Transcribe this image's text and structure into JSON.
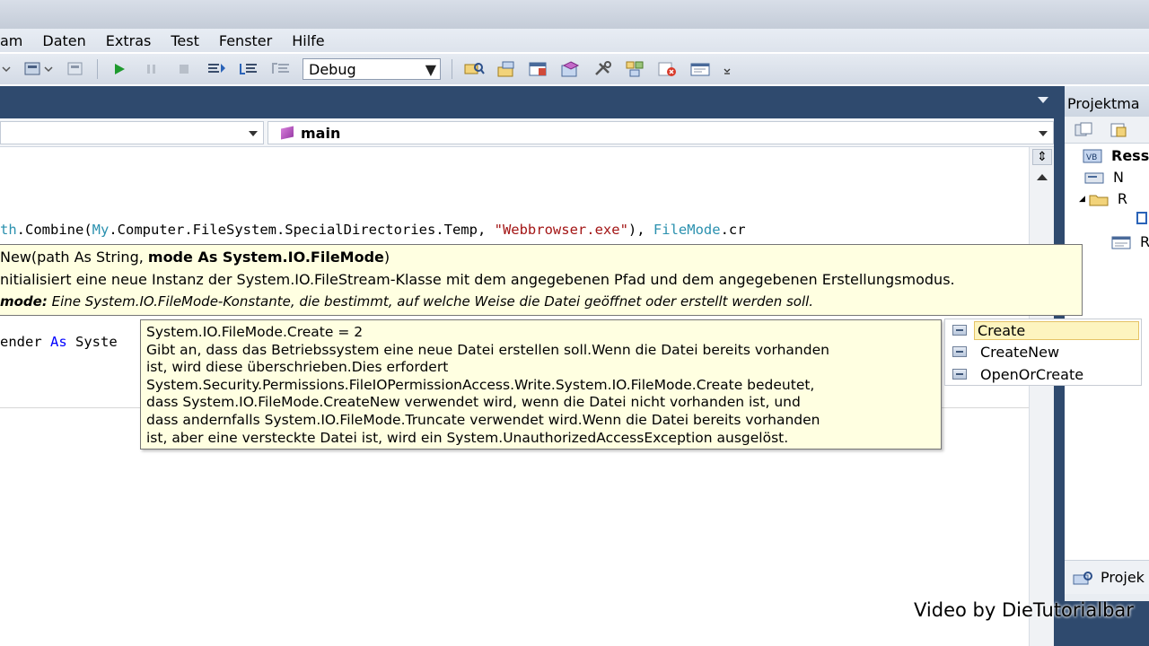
{
  "menu": {
    "items": [
      "am",
      "Daten",
      "Extras",
      "Test",
      "Fenster",
      "Hilfe"
    ]
  },
  "toolbar": {
    "config_combo": "Debug"
  },
  "navigation": {
    "member_dropdown": "main"
  },
  "code": {
    "line1": {
      "part1": "th",
      "part2": ".Combine(",
      "part3": "My",
      "part4": ".Computer.FileSystem.SpecialDirectories.Temp, ",
      "part5": "\"Webbrowser.exe\"",
      "part6": "), ",
      "part7": "FileMode",
      "part8": ".cr"
    },
    "line2": {
      "part1": "ender ",
      "part2": "As",
      "part3": " Syste"
    }
  },
  "signature_tooltip": {
    "sig_start": "New(path As String, ",
    "sig_bold": "mode As System.IO.FileMode",
    "sig_end": ")",
    "description": "nitialisiert eine neue Instanz der System.IO.FileStream-Klasse mit dem angegebenen Pfad und dem angegebenen Erstellungsmodus.",
    "param_name": "mode:",
    "param_desc": " Eine System.IO.FileMode-Konstante, die bestimmt, auf welche Weise die Datei geöffnet oder erstellt werden soll."
  },
  "member_tooltip": {
    "lines": [
      "System.IO.FileMode.Create = 2",
      "Gibt an, dass das Betriebssystem eine neue Datei erstellen soll.Wenn die Datei bereits vorhanden",
      "ist, wird diese überschrieben.Dies erfordert",
      "System.Security.Permissions.FileIOPermissionAccess.Write.System.IO.FileMode.Create bedeutet,",
      "dass System.IO.FileMode.CreateNew verwendet wird, wenn die Datei nicht vorhanden ist, und",
      "dass andernfalls System.IO.FileMode.Truncate verwendet wird.Wenn die Datei bereits vorhanden",
      "ist, aber eine versteckte Datei ist, wird ein System.UnauthorizedAccessException ausgelöst."
    ]
  },
  "completion": {
    "items": [
      "Create",
      "CreateNew",
      "OpenOrCreate"
    ],
    "selected": "Create"
  },
  "solution_explorer": {
    "title": "Projektma",
    "tree": [
      "Ress",
      "N",
      "R",
      "",
      "R"
    ],
    "bottom_tab": "Projek"
  },
  "watermark": "Video by DieTutorialbar",
  "colors": {
    "tooltip_bg": "#ffffe1",
    "dark_chrome": "#2f4a6e",
    "keyword": "#0000ff",
    "type": "#2b91af",
    "string": "#a31515"
  }
}
